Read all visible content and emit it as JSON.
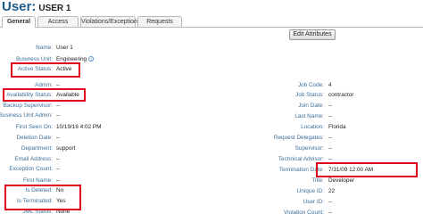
{
  "header": {
    "title": "User:",
    "name": "USER 1"
  },
  "tabs": [
    {
      "label": "General"
    },
    {
      "label": "Access"
    },
    {
      "label": "Violations/Exceptions"
    },
    {
      "label": "Requests"
    }
  ],
  "actions": {
    "edit_label": "Edit Attributes"
  },
  "left_fields": [
    {
      "label": "Name:",
      "value": "User 1"
    },
    {
      "label": "Business Unit:",
      "value": "Engineering"
    },
    {
      "label": "Active Status:",
      "value": "Active"
    },
    {
      "label": "Admin:",
      "value": "--"
    },
    {
      "label": "Availability Status:",
      "value": "Available"
    },
    {
      "label": "Backup Supervisor:",
      "value": "--"
    },
    {
      "label": "Business Unit Admin:",
      "value": "--"
    },
    {
      "label": "First Seen On:",
      "value": "10/19/16 4:02 PM"
    },
    {
      "label": "Deletion Date:",
      "value": "--"
    },
    {
      "label": "Department:",
      "value": "support"
    },
    {
      "label": "Email Address:",
      "value": "--"
    },
    {
      "label": "Exception Count:",
      "value": "--"
    },
    {
      "label": "First Name:",
      "value": "--"
    },
    {
      "label": "Is Deleted:",
      "value": "No"
    },
    {
      "label": "Is Terminated:",
      "value": "Yes"
    },
    {
      "label": "JML Status:",
      "value": "None"
    }
  ],
  "right_fields": [
    {
      "label": "Job Code:",
      "value": "4"
    },
    {
      "label": "Job Status:",
      "value": "contractor"
    },
    {
      "label": "Join Date:",
      "value": "--"
    },
    {
      "label": "Last Name:",
      "value": "--"
    },
    {
      "label": "Location:",
      "value": "Florida"
    },
    {
      "label": "Request Delegates:",
      "value": "--"
    },
    {
      "label": "Supervisor:",
      "value": "--"
    },
    {
      "label": "Technical Advisor:",
      "value": "--"
    },
    {
      "label": "Termination Date:",
      "value": "7/31/09 12:00 AM"
    },
    {
      "label": "Title:",
      "value": "Developer"
    },
    {
      "label": "Unique ID:",
      "value": "22"
    },
    {
      "label": "User ID:",
      "value": "--"
    },
    {
      "label": "Violation Count:",
      "value": "--"
    }
  ],
  "colors": {
    "label": "#3d6f9a",
    "highlight": "#e0001b",
    "title": "#1d5c8a"
  }
}
